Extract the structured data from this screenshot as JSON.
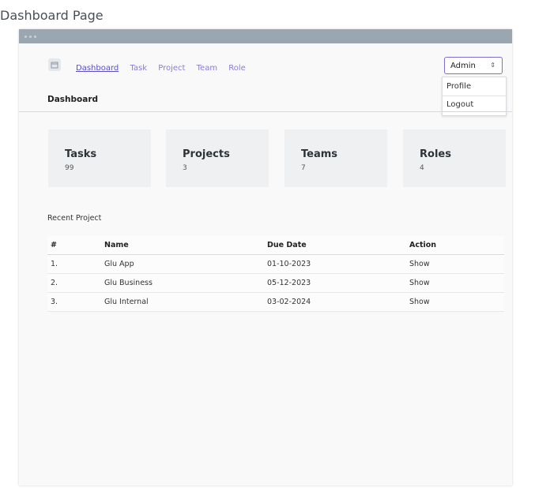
{
  "page": {
    "title": "Dashboard Page"
  },
  "nav": {
    "links": [
      "Dashboard",
      "Task",
      "Project",
      "Team",
      "Role"
    ],
    "active": "Dashboard"
  },
  "user_menu": {
    "selected": "Admin",
    "items": [
      "Profile",
      "Logout"
    ]
  },
  "header": {
    "title": "Dashboard"
  },
  "stats": [
    {
      "label": "Tasks",
      "value": "99"
    },
    {
      "label": "Projects",
      "value": "3"
    },
    {
      "label": "Teams",
      "value": "7"
    },
    {
      "label": "Roles",
      "value": "4"
    }
  ],
  "recent": {
    "title": "Recent Project",
    "columns": [
      "#",
      "Name",
      "Due Date",
      "Action"
    ],
    "rows": [
      {
        "num": "1.",
        "name": "Glu App",
        "due": "01-10-2023",
        "action": "Show"
      },
      {
        "num": "2.",
        "name": "Glu Business",
        "due": "05-12-2023",
        "action": "Show"
      },
      {
        "num": "3.",
        "name": "Glu Internal",
        "due": "03-02-2024",
        "action": "Show"
      }
    ]
  },
  "colors": {
    "accent": "#5b4fc7",
    "titlebar": "#9aa7b1",
    "card_bg": "#eef0f2"
  },
  "icons": {
    "nav": "calendar-icon",
    "select": "updown-arrows-icon"
  }
}
